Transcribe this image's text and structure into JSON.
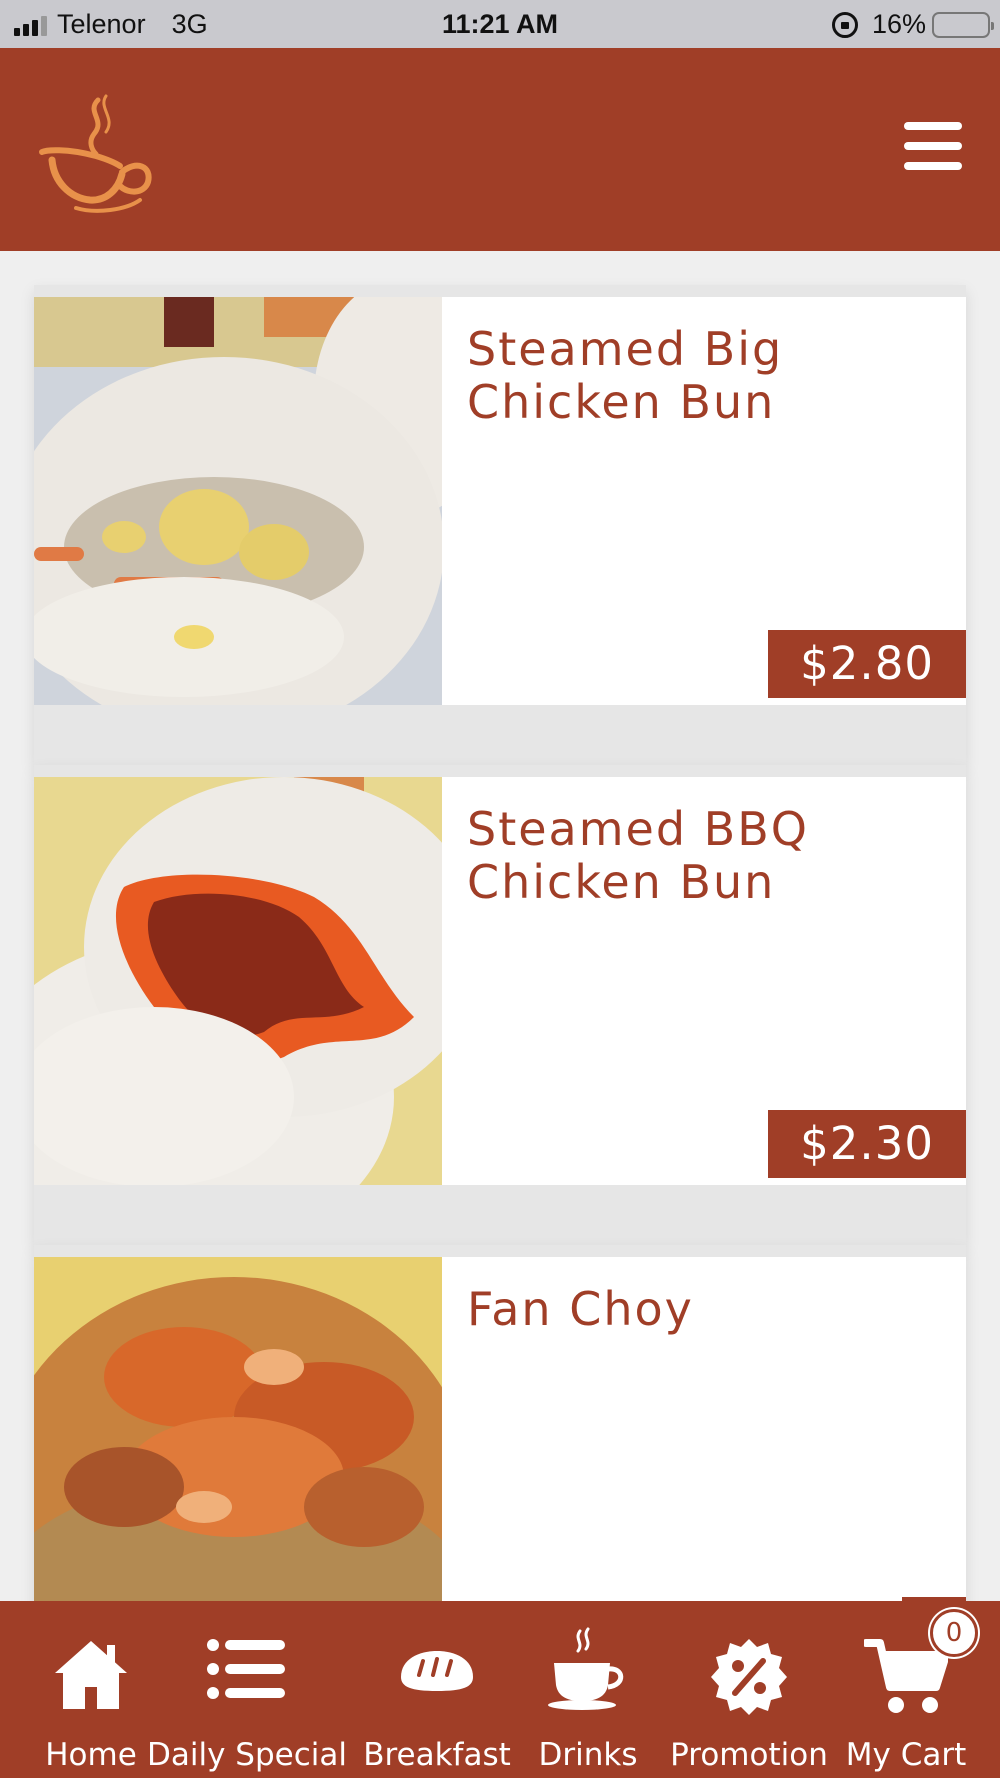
{
  "status_bar": {
    "carrier": "Telenor",
    "network": "3G",
    "time": "11:21 AM",
    "battery": "16%",
    "battery_level": 0.16
  },
  "header": {
    "logo_icon": "coffee-cup-logo-icon",
    "menu_icon": "hamburger-menu-icon"
  },
  "products": [
    {
      "name": "Steamed Big Chicken Bun",
      "price": "$2.80",
      "image": "steamed-chicken-bun-photo"
    },
    {
      "name": "Steamed BBQ Chicken Bun",
      "price": "$2.30",
      "image": "bbq-chicken-bun-photo"
    },
    {
      "name": "Fan Choy",
      "price": "",
      "image": "fan-choy-photo"
    }
  ],
  "nav": [
    {
      "label": "Home",
      "icon": "home-icon"
    },
    {
      "label": "Daily Special",
      "icon": "list-icon"
    },
    {
      "label": "Breakfast",
      "icon": "bread-icon"
    },
    {
      "label": "Drinks",
      "icon": "coffee-cup-icon"
    },
    {
      "label": "Promotion",
      "icon": "percent-badge-icon"
    },
    {
      "label": "My Cart",
      "icon": "cart-icon",
      "badge": "0"
    }
  ],
  "colors": {
    "brand": "#a03e27",
    "logo": "#e8914a",
    "background": "#efefef"
  }
}
